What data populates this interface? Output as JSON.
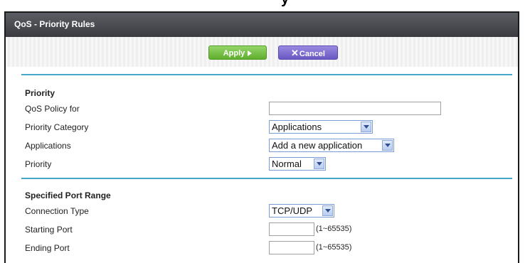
{
  "top_title_fragment": "y",
  "panel": {
    "title": "QoS - Priority Rules"
  },
  "buttons": {
    "apply_label": "Apply",
    "cancel_label": "Cancel"
  },
  "priority_section": {
    "heading": "Priority",
    "fields": {
      "qos_policy_for": {
        "label": "QoS Policy for",
        "value": ""
      },
      "priority_category": {
        "label": "Priority Category",
        "value": "Applications"
      },
      "applications": {
        "label": "Applications",
        "value": "Add a new application"
      },
      "priority": {
        "label": "Priority",
        "value": "Normal"
      }
    }
  },
  "port_section": {
    "heading": "Specified Port Range",
    "fields": {
      "connection_type": {
        "label": "Connection Type",
        "value": "TCP/UDP"
      },
      "starting_port": {
        "label": "Starting Port",
        "value": "",
        "hint": "(1~65535)"
      },
      "ending_port": {
        "label": "Ending Port",
        "value": "",
        "hint": "(1~65535)"
      }
    }
  },
  "colors": {
    "header_bg": "#4a4c50",
    "apply_green": "#6cbf3a",
    "cancel_purple": "#7b68d3",
    "separator_blue": "#49a7c9"
  },
  "icons": {
    "apply": "arrow-right-icon",
    "cancel": "x-icon",
    "dropdown": "chevron-down-icon"
  }
}
